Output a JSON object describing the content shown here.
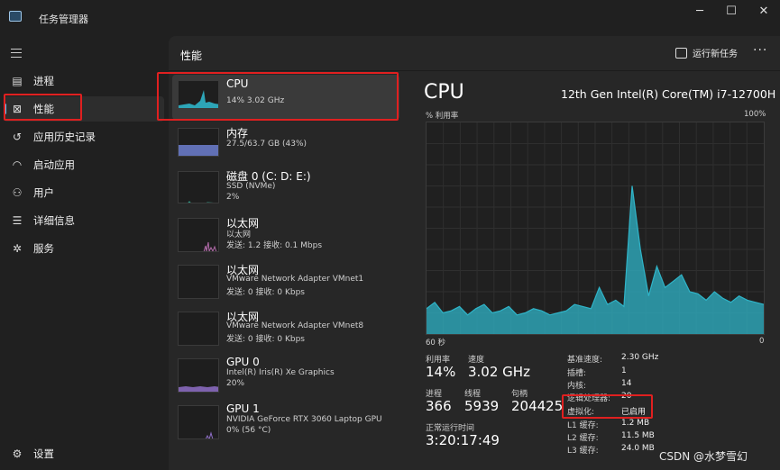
{
  "window": {
    "title": "任务管理器",
    "minimize": "─",
    "maximize": "☐",
    "close": "✕"
  },
  "sidebar": {
    "items": [
      {
        "label": "进程",
        "icon": "processes-icon"
      },
      {
        "label": "性能",
        "icon": "performance-icon"
      },
      {
        "label": "应用历史记录",
        "icon": "app-history-icon"
      },
      {
        "label": "启动应用",
        "icon": "startup-apps-icon"
      },
      {
        "label": "用户",
        "icon": "users-icon"
      },
      {
        "label": "详细信息",
        "icon": "details-icon"
      },
      {
        "label": "服务",
        "icon": "services-icon"
      }
    ],
    "settings": {
      "label": "设置",
      "icon": "gear-icon"
    }
  },
  "header": {
    "title": "性能",
    "run_new_task": "运行新任务",
    "more": "···"
  },
  "devices": [
    {
      "name": "CPU",
      "lines": [
        "14%  3.02 GHz"
      ],
      "color": "#2fb4c8"
    },
    {
      "name": "内存",
      "lines": [
        "27.5/63.7 GB (43%)"
      ],
      "color": "#6d7fd0",
      "fill": 0.43
    },
    {
      "name": "磁盘 0 (C: D: E:)",
      "lines": [
        "SSD (NVMe)",
        "2%"
      ],
      "color": "#2fa08a"
    },
    {
      "name": "以太网",
      "lines": [
        "以太网",
        "发送: 1.2  接收: 0.1 Mbps"
      ],
      "color": "#b06aa8"
    },
    {
      "name": "以太网",
      "lines": [
        "VMware Network Adapter VMnet1",
        "发送: 0  接收: 0 Kbps"
      ],
      "color": "#b06aa8"
    },
    {
      "name": "以太网",
      "lines": [
        "VMware Network Adapter VMnet8",
        "发送: 0  接收: 0 Kbps"
      ],
      "color": "#b06aa8"
    },
    {
      "name": "GPU 0",
      "lines": [
        "Intel(R) Iris(R) Xe Graphics",
        "20%"
      ],
      "color": "#8f6fc8"
    },
    {
      "name": "GPU 1",
      "lines": [
        "NVIDIA GeForce RTX 3060 Laptop GPU",
        "0%  (56 °C)"
      ],
      "color": "#8f6fc8"
    }
  ],
  "detail": {
    "title": "CPU",
    "model": "12th Gen Intel(R) Core(TM) i7-12700H",
    "y_label": "% 利用率",
    "y_max": "100%",
    "x_left": "60 秒",
    "x_right": "0",
    "utilization_label": "利用率",
    "utilization": "14%",
    "speed_label": "速度",
    "speed": "3.02 GHz",
    "processes_label": "进程",
    "processes": "366",
    "threads_label": "线程",
    "threads": "5939",
    "handles_label": "句柄",
    "handles": "204425",
    "uptime_label": "正常运行时间",
    "uptime": "3:20:17:49",
    "specs": [
      {
        "k": "基准速度:",
        "v": "2.30 GHz"
      },
      {
        "k": "插槽:",
        "v": "1"
      },
      {
        "k": "内核:",
        "v": "14"
      },
      {
        "k": "逻辑处理器:",
        "v": "20"
      },
      {
        "k": "虚拟化:",
        "v": "已启用"
      },
      {
        "k": "L1 缓存:",
        "v": "1.2 MB"
      },
      {
        "k": "L2 缓存:",
        "v": "11.5 MB"
      },
      {
        "k": "L3 缓存:",
        "v": "24.0 MB"
      }
    ]
  },
  "chart_data": {
    "type": "area",
    "x_range": [
      "60 秒",
      "0"
    ],
    "ylim": [
      0,
      100
    ],
    "color": "#2fb4c8",
    "values": [
      12,
      15,
      10,
      11,
      13,
      9,
      12,
      14,
      10,
      11,
      13,
      9,
      10,
      12,
      11,
      9,
      10,
      11,
      14,
      13,
      12,
      22,
      14,
      16,
      13,
      70,
      40,
      18,
      32,
      22,
      25,
      28,
      20,
      19,
      16,
      20,
      17,
      15,
      18,
      16,
      15,
      14
    ]
  },
  "watermark": "CSDN @水梦雪幻"
}
